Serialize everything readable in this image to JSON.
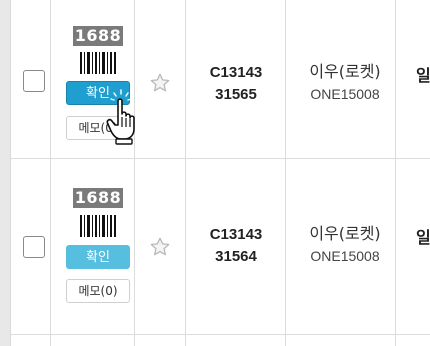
{
  "rows": [
    {
      "logo": "1688",
      "confirm_label": "확인",
      "memo_label": "메모(0)",
      "order_id_line1": "C13143",
      "order_id_line2": "31565",
      "seller_name": "이우(로켓)",
      "seller_code": "ONE15008",
      "next_col_text": "일",
      "next_col_sub": "$"
    },
    {
      "logo": "1688",
      "confirm_label": "확인",
      "memo_label": "메모(0)",
      "order_id_line1": "C13143",
      "order_id_line2": "31564",
      "seller_name": "이우(로켓)",
      "seller_code": "ONE15008",
      "next_col_text": "일",
      "next_col_sub": "$"
    }
  ],
  "colors": {
    "confirm_active": "#1e9fcf",
    "confirm_normal": "#56bfe0",
    "logo_bg": "#7a7a7a",
    "grid": "#dcdcdc",
    "star": "#b8b8b8"
  },
  "icons": [
    "star-outline-icon",
    "barcode-icon",
    "hand-pointer-cursor-icon",
    "1688-logo"
  ]
}
